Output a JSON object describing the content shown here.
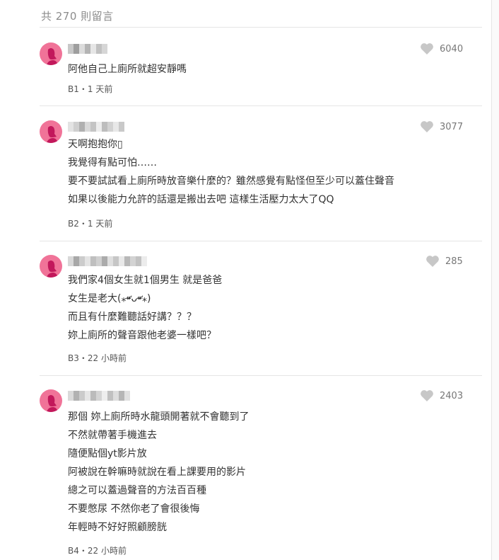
{
  "header": {
    "total_label": "共 270 則留言"
  },
  "comments": [
    {
      "floor_meta": "B1・1 天前",
      "likes": "6040",
      "lines": [
        "阿他自己上廁所就超安靜嗎"
      ]
    },
    {
      "floor_meta": "B2・1 天前",
      "likes": "3077",
      "lines": [
        "天啊抱抱你▯",
        "我覺得有點可怕……",
        "要不要試試看上廁所時放音樂什麼的？雖然感覺有點怪但至少可以蓋住聲音",
        "如果以後能力允許的話還是搬出去吧  這樣生活壓力太大了QQ"
      ]
    },
    {
      "floor_meta": "B3・22 小時前",
      "likes": "285",
      "lines": [
        "我們家4個女生就1個男生 就是爸爸",
        "女生是老大(⁎⁍̴̛ᴗ⁍̴̛⁎)",
        "而且有什麼難聽話好講？？？",
        "妳上廁所的聲音跟他老婆一樣吧？"
      ]
    },
    {
      "floor_meta": "B4・22 小時前",
      "likes": "2403",
      "lines": [
        "那個 妳上廁所時水龍頭開著就不會聽到了",
        "不然就帶著手機進去",
        "隨便點個yt影片放",
        "阿被說在幹嘛時就說在看上課要用的影片",
        "總之可以蓋過聲音的方法百百種",
        "不要憋尿 不然你老了會很後悔",
        "年輕時不好好照顧膀胱"
      ]
    }
  ],
  "colors": {
    "avatar": "#f07398",
    "heart": "#c7c7c7"
  },
  "icons": {
    "avatar": "female-avatar-icon",
    "like": "heart-icon"
  }
}
